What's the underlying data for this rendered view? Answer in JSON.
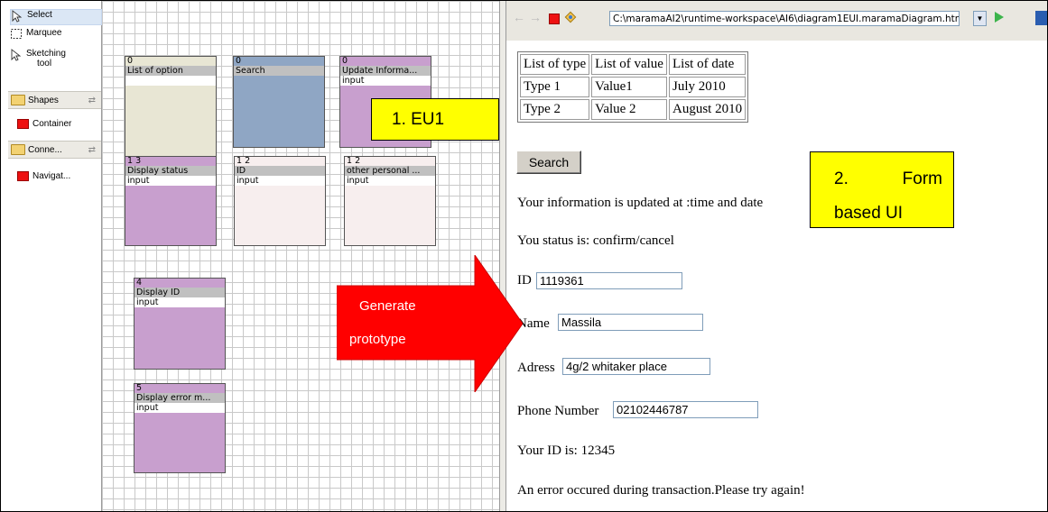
{
  "palette": {
    "tools": [
      {
        "label": "Select",
        "icon": "arrow-cursor-icon"
      },
      {
        "label": "Marquee",
        "icon": "marquee-icon"
      },
      {
        "label": "Sketching tool",
        "icon": "sketch-arrow-icon"
      }
    ],
    "drawers": [
      {
        "label": "Shapes",
        "items": [
          "Container"
        ]
      },
      {
        "label": "Conne...",
        "items": [
          "Navigat..."
        ]
      }
    ]
  },
  "canvas": {
    "shapes": [
      {
        "number": "0",
        "label": "List of option",
        "input": "",
        "fill": "#e8e6d4"
      },
      {
        "number": "0",
        "label": "Search",
        "input": "",
        "fill": "#8fa6c4"
      },
      {
        "number": "0",
        "label": "Update Informa...",
        "input": "input",
        "fill": "#c89fce"
      },
      {
        "number": "1 3",
        "label": "Display status",
        "input": "input",
        "fill": "#c89fce"
      },
      {
        "number": "1 2",
        "label": "ID",
        "input": "input",
        "fill": "#f7eeee"
      },
      {
        "number": "1 2",
        "label": "other personal ...",
        "input": "input",
        "fill": "#f7eeee"
      },
      {
        "number": "4",
        "label": "Display ID",
        "input": "input",
        "fill": "#c89fce"
      },
      {
        "number": "5",
        "label": "Display error m...",
        "input": "input",
        "fill": "#c89fce"
      }
    ]
  },
  "annotations": {
    "eu1": "1. EU1",
    "form_ui_line1_num": "2.",
    "form_ui_line1_word": "Form",
    "form_ui_line2": "based UI",
    "arrow_line1": "Generate",
    "arrow_line2": "prototype"
  },
  "browser": {
    "url": "C:\\maramaAI2\\runtime-workspace\\AI6\\diagram1EUI.maramaDiagram.html",
    "table": {
      "headers": [
        "List of type",
        "List of value",
        "List of date"
      ],
      "rows": [
        [
          "Type 1",
          "Value1",
          "July 2010"
        ],
        [
          "Type 2",
          "Value 2",
          "August 2010"
        ]
      ]
    },
    "search_button": "Search",
    "updated_text": "Your information is updated at :time and date",
    "status_text": "You status is: confirm/cancel",
    "fields": [
      {
        "label": "ID",
        "value": "1119361"
      },
      {
        "label": "Name",
        "value": "Massila"
      },
      {
        "label": "Adress",
        "value": "4g/2 whitaker place"
      },
      {
        "label": "Phone Number",
        "value": "02102446787"
      }
    ],
    "your_id_text": "Your ID is: 12345",
    "error_text": "An error occured during transaction.Please try again!"
  },
  "colors": {
    "arrow": "#ff0000",
    "callout": "#ffff00",
    "purple_shape": "#c89fce",
    "blue_shape": "#8fa6c4"
  }
}
